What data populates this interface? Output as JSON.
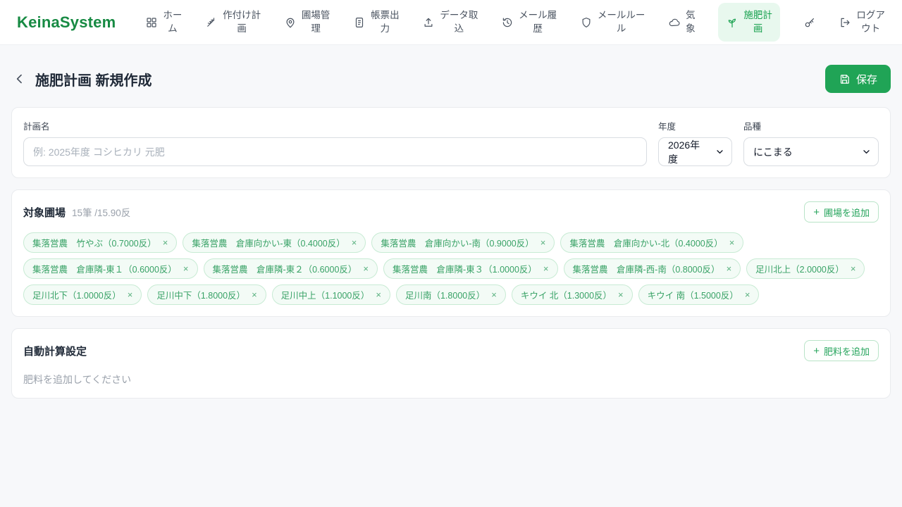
{
  "brand": {
    "name": "KeinaSystem"
  },
  "nav": {
    "items": [
      {
        "label": "ホー\nム",
        "icon": "grid-icon"
      },
      {
        "label": "作付け計\n画",
        "icon": "wheat-icon"
      },
      {
        "label": "圃場管\n理",
        "icon": "map-pin-icon"
      },
      {
        "label": "帳票出\n力",
        "icon": "document-icon"
      },
      {
        "label": "データ取\n込",
        "icon": "upload-icon"
      },
      {
        "label": "メール履\n歴",
        "icon": "history-icon"
      },
      {
        "label": "メールルー\nル",
        "icon": "shield-icon"
      },
      {
        "label": "気\n象",
        "icon": "cloud-icon"
      },
      {
        "label": "施肥計\n画",
        "icon": "sprout-icon",
        "active": true
      },
      {
        "label": "ログア\nウト",
        "icon": "logout-icon"
      }
    ]
  },
  "page": {
    "title": "施肥計画 新規作成",
    "save_label": "保存"
  },
  "plan": {
    "name_label": "計画名",
    "name_placeholder": "例: 2025年度 コシヒカリ 元肥",
    "year_label": "年度",
    "year_value": "2026年度",
    "variety_label": "品種",
    "variety_value": "にこまる"
  },
  "fields": {
    "title": "対象圃場",
    "summary": "15筆 /15.90反",
    "add_button": {
      "label": "圃場を追加"
    },
    "chips": [
      {
        "label": "集落営農　竹やぶ（0.7000反）"
      },
      {
        "label": "集落営農　倉庫向かい-東（0.4000反）"
      },
      {
        "label": "集落営農　倉庫向かい-南（0.9000反）"
      },
      {
        "label": "集落営農　倉庫向かい-北（0.4000反）"
      },
      {
        "label": "集落営農　倉庫隣-東１（0.6000反）"
      },
      {
        "label": "集落営農　倉庫隣-東２（0.6000反）"
      },
      {
        "label": "集落営農　倉庫隣-東３（1.0000反）"
      },
      {
        "label": "集落営農　倉庫隣-西-南（0.8000反）"
      },
      {
        "label": "足川北上（2.0000反）"
      },
      {
        "label": "足川北下（1.0000反）"
      },
      {
        "label": "足川中下（1.8000反）"
      },
      {
        "label": "足川中上（1.1000反）"
      },
      {
        "label": "足川南（1.8000反）"
      },
      {
        "label": "キウイ 北（1.3000反）"
      },
      {
        "label": "キウイ 南（1.5000反）"
      }
    ]
  },
  "auto_calc": {
    "title": "自動計算設定",
    "add_button": {
      "label": "肥料を追加"
    },
    "empty_message": "肥料を追加してください"
  },
  "icons": {
    "close": "×",
    "plus": "+"
  },
  "colors": {
    "brand_green": "#178a43",
    "button_green": "#20a456",
    "active_pill_bg": "#e8f8ee",
    "chip_bg": "#f3fbf6",
    "chip_border": "#c8ebd4",
    "chip_text": "#38a266",
    "page_bg": "#f7f8fa"
  }
}
